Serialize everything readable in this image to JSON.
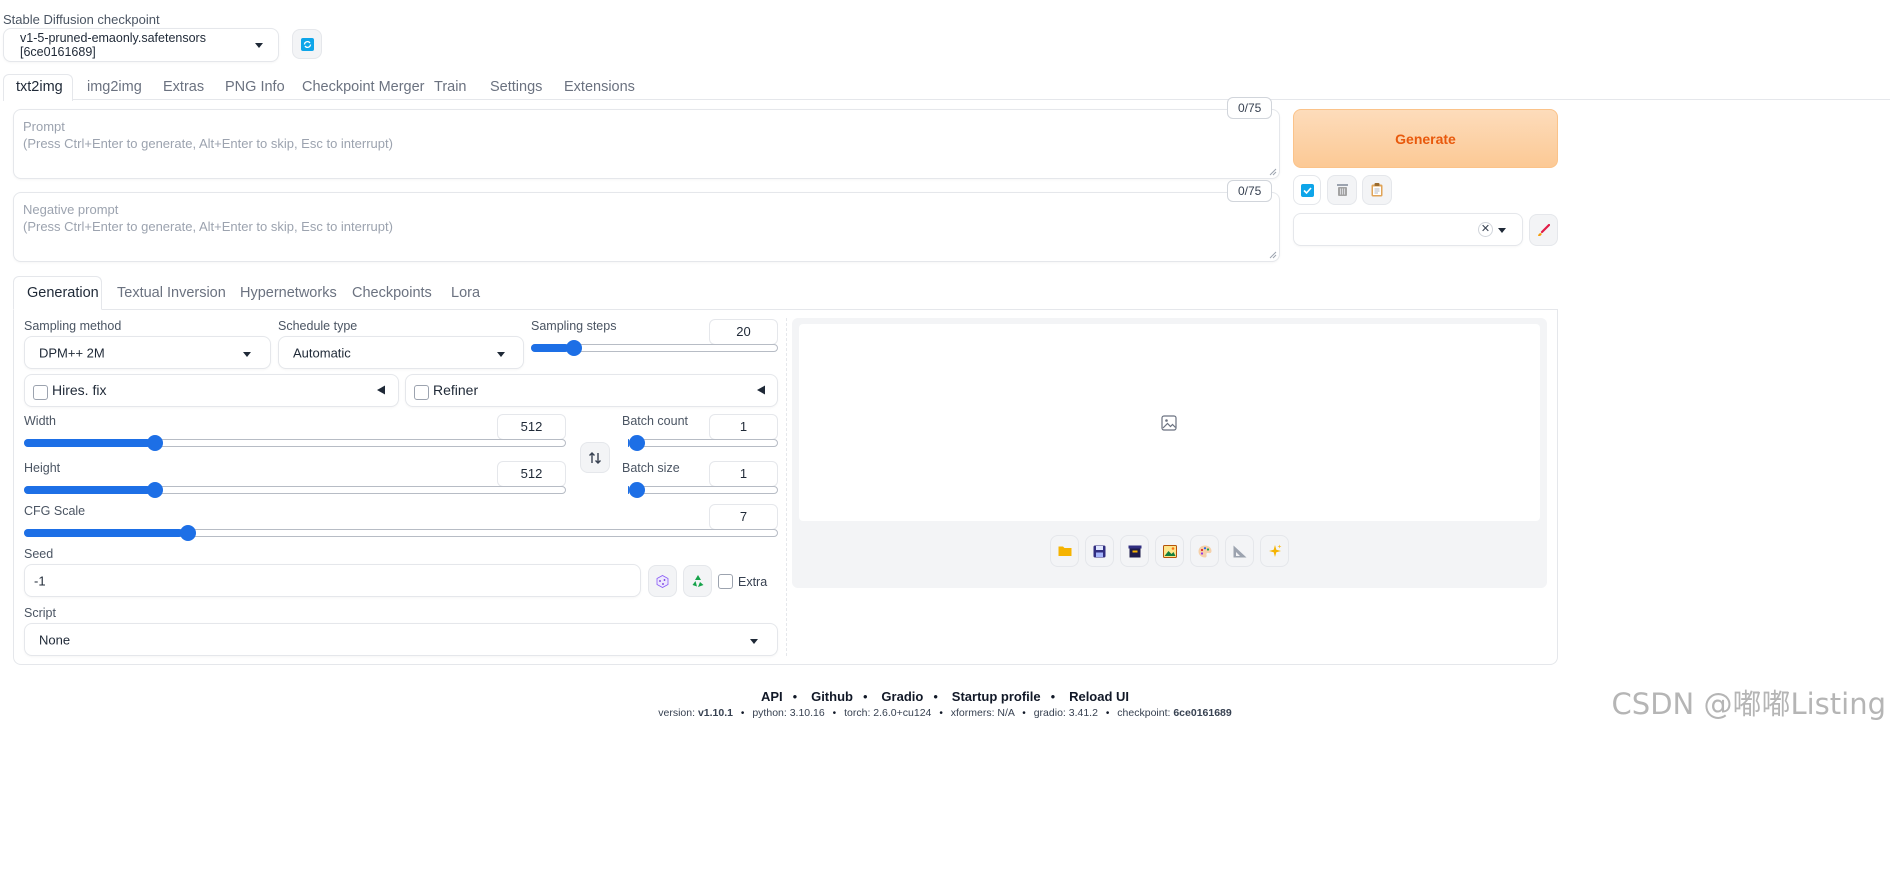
{
  "checkpoint": {
    "label": "Stable Diffusion checkpoint",
    "value": "v1-5-pruned-emaonly.safetensors [6ce0161689]"
  },
  "main_tabs": [
    "txt2img",
    "img2img",
    "Extras",
    "PNG Info",
    "Checkpoint Merger",
    "Train",
    "Settings",
    "Extensions"
  ],
  "prompt": {
    "label": "Prompt",
    "placeholder": "(Press Ctrl+Enter to generate, Alt+Enter to skip, Esc to interrupt)",
    "counter": "0/75"
  },
  "negative_prompt": {
    "label": "Negative prompt",
    "placeholder": "(Press Ctrl+Enter to generate, Alt+Enter to skip, Esc to interrupt)",
    "counter": "0/75"
  },
  "generate_label": "Generate",
  "sub_tabs": [
    "Generation",
    "Textual Inversion",
    "Hypernetworks",
    "Checkpoints",
    "Lora"
  ],
  "sampling_method": {
    "label": "Sampling method",
    "value": "DPM++ 2M"
  },
  "schedule_type": {
    "label": "Schedule type",
    "value": "Automatic"
  },
  "sampling_steps": {
    "label": "Sampling steps",
    "value": "20",
    "fraction": 0.15
  },
  "hires_fix": {
    "label": "Hires. fix",
    "checked": false
  },
  "refiner": {
    "label": "Refiner",
    "checked": false
  },
  "width": {
    "label": "Width",
    "value": "512",
    "fraction": 0.233
  },
  "height": {
    "label": "Height",
    "value": "512",
    "fraction": 0.233
  },
  "batch_count": {
    "label": "Batch count",
    "value": "1",
    "fraction": 0.0
  },
  "batch_size": {
    "label": "Batch size",
    "value": "1",
    "fraction": 0.0
  },
  "cfg_scale": {
    "label": "CFG Scale",
    "value": "7",
    "fraction": 0.21
  },
  "seed": {
    "label": "Seed",
    "value": "-1",
    "extra_label": "Extra"
  },
  "script": {
    "label": "Script",
    "value": "None"
  },
  "footer": {
    "links": [
      "API",
      "Github",
      "Gradio",
      "Startup profile",
      "Reload UI"
    ],
    "version_label": "version:",
    "version": "v1.10.1",
    "python": "python: 3.10.16",
    "torch": "torch: 2.6.0+cu124",
    "xformers": "xformers: N/A",
    "gradio": "gradio: 3.41.2",
    "checkpoint_label": "checkpoint:",
    "checkpoint": "6ce0161689"
  },
  "watermark": "CSDN @嘟嘟Listing",
  "colors": {
    "accent": "#1d6fe6",
    "generate_bg": "#fdd1a8",
    "generate_text": "#e8590c",
    "checkbox_blue": "#0ea5e9"
  }
}
